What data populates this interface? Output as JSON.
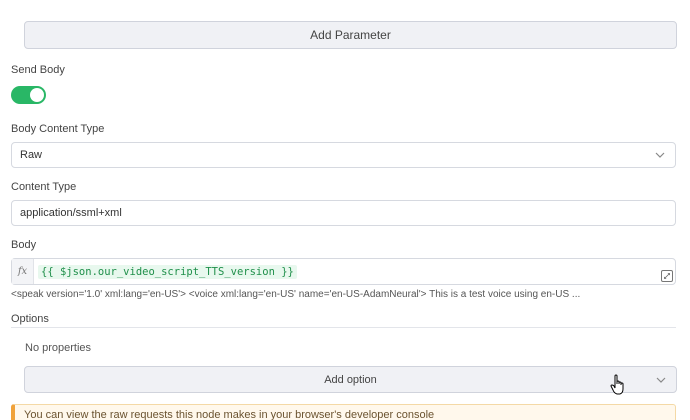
{
  "add_parameter_label": "Add Parameter",
  "send_body": {
    "label": "Send Body",
    "enabled": true
  },
  "body_content_type": {
    "label": "Body Content Type",
    "value": "Raw"
  },
  "content_type": {
    "label": "Content Type",
    "value": "application/ssml+xml"
  },
  "body": {
    "label": "Body",
    "fx_icon": "fx",
    "expression": "{{ $json.our_video_script_TTS_version }}",
    "preview": "<speak version='1.0' xml:lang='en-US'>    <voice xml:lang='en-US' name='en-US-AdamNeural'>     This is a test voice using en-US ..."
  },
  "options": {
    "label": "Options",
    "empty_text": "No properties",
    "add_option_label": "Add option"
  },
  "notice": "You can view the raw requests this node makes in your browser's developer console",
  "colors": {
    "toggle_on": "#29b766",
    "expression_text": "#1f8f4a",
    "notice_border": "#f0a23a"
  }
}
